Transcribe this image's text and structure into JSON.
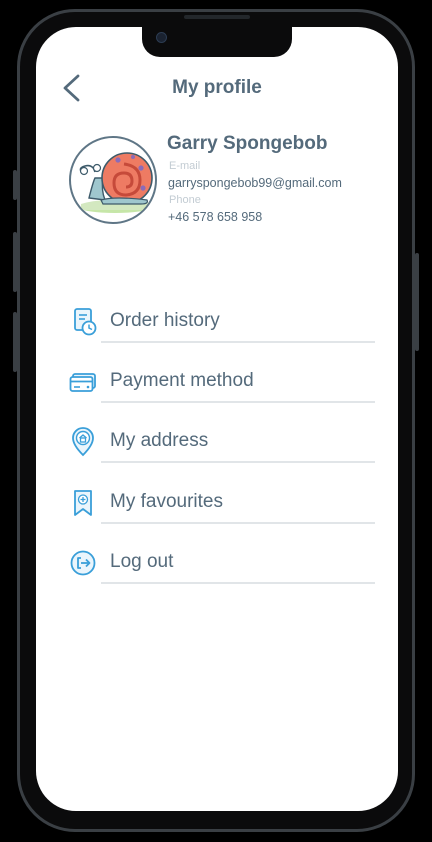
{
  "header": {
    "title": "My profile"
  },
  "profile": {
    "name": "Garry Spongebob",
    "email_label": "E-mail",
    "email": "garryspongebob99@gmail.com",
    "phone_label": "Phone",
    "phone": "+46 578 658 958"
  },
  "menu": {
    "items": [
      {
        "label": "Order history",
        "icon": "receipt-clock-icon"
      },
      {
        "label": "Payment method",
        "icon": "credit-card-icon"
      },
      {
        "label": "My address",
        "icon": "location-home-icon"
      },
      {
        "label": "My favourites",
        "icon": "bookmark-plus-icon"
      },
      {
        "label": "Log out",
        "icon": "logout-icon"
      }
    ]
  },
  "colors": {
    "text": "#546a7b",
    "accent": "#3a9fd9",
    "divider": "#e1e5e8",
    "muted": "#c3ccd3"
  }
}
